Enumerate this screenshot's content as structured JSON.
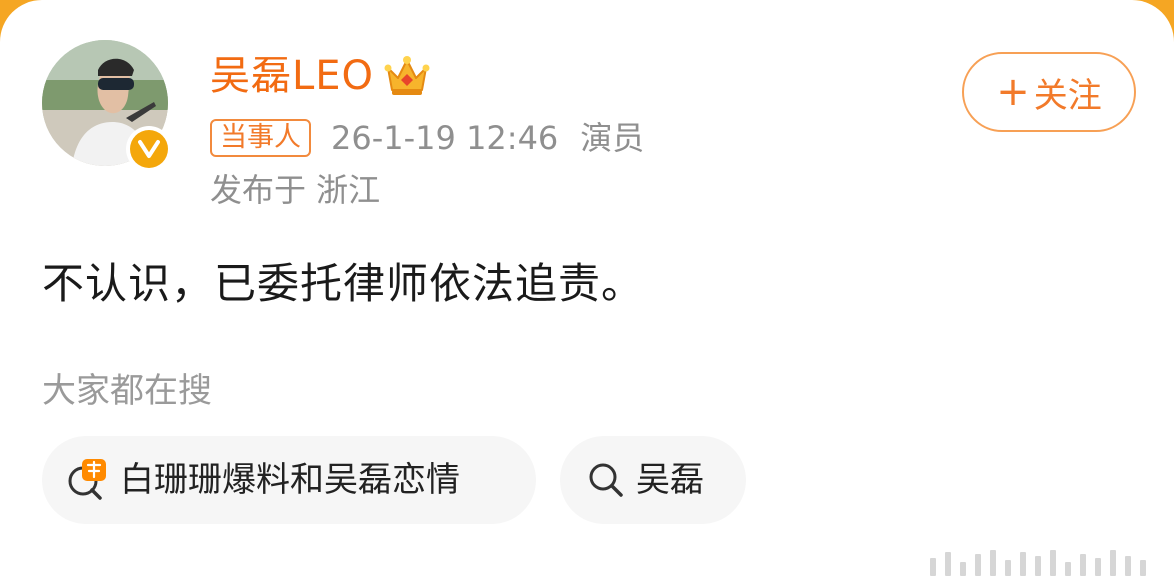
{
  "post": {
    "author": {
      "name": "吴磊LEO",
      "verified_icon": "verified-v-icon",
      "vip_icon": "crown-icon"
    },
    "badge": "当事人",
    "time": "26-1-19 12:46",
    "role": "演员",
    "location": "发布于 浙江",
    "follow_label": "关注",
    "follow_plus": "+",
    "content": "不认识，已委托律师依法追责。"
  },
  "search": {
    "heading": "大家都在搜",
    "items": [
      {
        "label": "白珊珊爆料和吴磊恋情",
        "icon": "hot-search-icon"
      },
      {
        "label": "吴磊",
        "icon": "search-icon"
      }
    ]
  },
  "colors": {
    "accent": "#f26b12",
    "verified": "#f4a70b",
    "meta_text": "#8f8f8f",
    "chip_bg": "#f6f6f6"
  }
}
